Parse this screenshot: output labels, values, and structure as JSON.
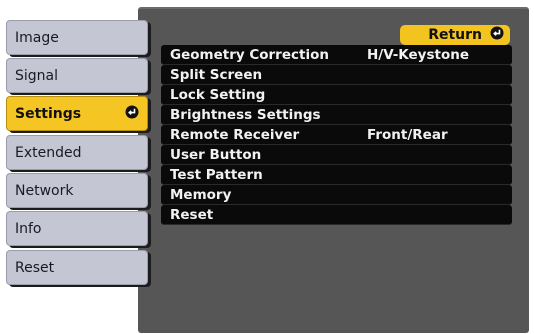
{
  "sidebar": {
    "items": [
      {
        "label": "Image"
      },
      {
        "label": "Signal"
      },
      {
        "label": "Settings"
      },
      {
        "label": "Extended"
      },
      {
        "label": "Network"
      },
      {
        "label": "Info"
      },
      {
        "label": "Reset"
      }
    ],
    "active_index": 2
  },
  "panel": {
    "return_label": "Return",
    "menu": [
      {
        "label": "Geometry Correction",
        "value": "H/V-Keystone"
      },
      {
        "label": "Split Screen",
        "value": ""
      },
      {
        "label": "Lock Setting",
        "value": ""
      },
      {
        "label": "Brightness Settings",
        "value": ""
      },
      {
        "label": "Remote Receiver",
        "value": "Front/Rear"
      },
      {
        "label": "User Button",
        "value": ""
      },
      {
        "label": "Test Pattern",
        "value": ""
      },
      {
        "label": "Memory",
        "value": ""
      },
      {
        "label": "Reset",
        "value": ""
      }
    ]
  },
  "colors": {
    "accent": "#f3c41f",
    "tab_inactive": "#c5c6d4",
    "panel": "#565656",
    "menu_row": "#0a0a0a"
  },
  "icons": {
    "enter": "enter-icon"
  }
}
